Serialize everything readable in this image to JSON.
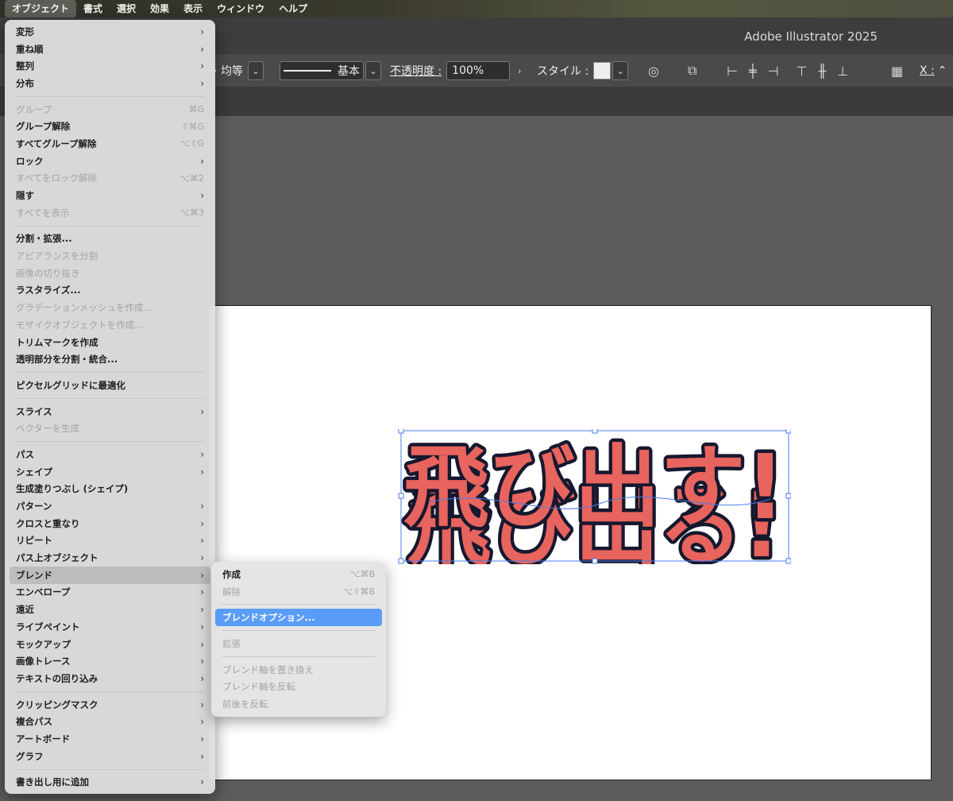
{
  "menubar": {
    "items": [
      "オブジェクト",
      "書式",
      "選択",
      "効果",
      "表示",
      "ウィンドウ",
      "ヘルプ"
    ]
  },
  "app": {
    "title": "Adobe Illustrator 2025"
  },
  "controlbar": {
    "stroke_profile": "均等",
    "brush": "基本",
    "opacity_label": "不透明度 :",
    "opacity_value": "100%",
    "style_label": "スタイル :",
    "x_label": "X :"
  },
  "object_menu": {
    "items": [
      {
        "label": "変形",
        "submenu": true
      },
      {
        "label": "重ね順",
        "submenu": true
      },
      {
        "label": "整列",
        "submenu": true
      },
      {
        "label": "分布",
        "submenu": true
      },
      {
        "sep": true
      },
      {
        "label": "グループ",
        "disabled": true,
        "shortcut": "⌘G"
      },
      {
        "label": "グループ解除",
        "disabled": false,
        "shortcut": "⇧⌘G"
      },
      {
        "label": "すべてグループ解除",
        "shortcut": "⌥⇧G"
      },
      {
        "label": "ロック",
        "submenu": true
      },
      {
        "label": "すべてをロック解除",
        "disabled": true,
        "shortcut": "⌥⌘2"
      },
      {
        "label": "隠す",
        "submenu": true
      },
      {
        "label": "すべてを表示",
        "disabled": true,
        "shortcut": "⌥⌘3"
      },
      {
        "sep": true
      },
      {
        "label": "分割・拡張..."
      },
      {
        "label": "アピアランスを分割",
        "disabled": true
      },
      {
        "label": "画像の切り抜き",
        "disabled": true
      },
      {
        "label": "ラスタライズ..."
      },
      {
        "label": "グラデーションメッシュを作成...",
        "disabled": true
      },
      {
        "label": "モザイクオブジェクトを作成...",
        "disabled": true
      },
      {
        "label": "トリムマークを作成"
      },
      {
        "label": "透明部分を分割・統合..."
      },
      {
        "sep": true
      },
      {
        "label": "ピクセルグリッドに最適化"
      },
      {
        "sep": true
      },
      {
        "label": "スライス",
        "submenu": true
      },
      {
        "label": "ベクターを生成",
        "disabled": true
      },
      {
        "sep": true
      },
      {
        "label": "パス",
        "submenu": true
      },
      {
        "label": "シェイプ",
        "submenu": true
      },
      {
        "label": "生成塗りつぶし (シェイプ)"
      },
      {
        "label": "パターン",
        "submenu": true
      },
      {
        "label": "クロスと重なり",
        "submenu": true
      },
      {
        "label": "リピート",
        "submenu": true
      },
      {
        "label": "パス上オブジェクト",
        "submenu": true
      },
      {
        "label": "ブレンド",
        "submenu": true,
        "hover": true
      },
      {
        "label": "エンベロープ",
        "submenu": true
      },
      {
        "label": "遠近",
        "submenu": true
      },
      {
        "label": "ライブペイント",
        "submenu": true
      },
      {
        "label": "モックアップ",
        "submenu": true
      },
      {
        "label": "画像トレース",
        "submenu": true
      },
      {
        "label": "テキストの回り込み",
        "submenu": true
      },
      {
        "sep": true
      },
      {
        "label": "クリッピングマスク",
        "submenu": true
      },
      {
        "label": "複合パス",
        "submenu": true
      },
      {
        "label": "アートボード",
        "submenu": true
      },
      {
        "label": "グラフ",
        "submenu": true
      },
      {
        "sep": true
      },
      {
        "label": "書き出し用に追加",
        "submenu": true
      }
    ]
  },
  "blend_submenu": {
    "items": [
      {
        "label": "作成",
        "shortcut": "⌥⌘B"
      },
      {
        "label": "解除",
        "disabled": true,
        "shortcut": "⌥⇧⌘B"
      },
      {
        "sep": true
      },
      {
        "label": "ブレンドオプション...",
        "selected": true
      },
      {
        "sep": true
      },
      {
        "label": "拡張",
        "disabled": true
      },
      {
        "sep": true
      },
      {
        "label": "ブレンド軸を置き換え",
        "disabled": true
      },
      {
        "label": "ブレンド軸を反転",
        "disabled": true
      },
      {
        "label": "前後を反転",
        "disabled": true
      }
    ]
  },
  "artwork": {
    "top_text": "飛び出す!",
    "bottom_text": "飛び出る!",
    "fill_color": "#e8645e",
    "stroke_color": "#16182e",
    "selection_color": "#4a7de8"
  }
}
